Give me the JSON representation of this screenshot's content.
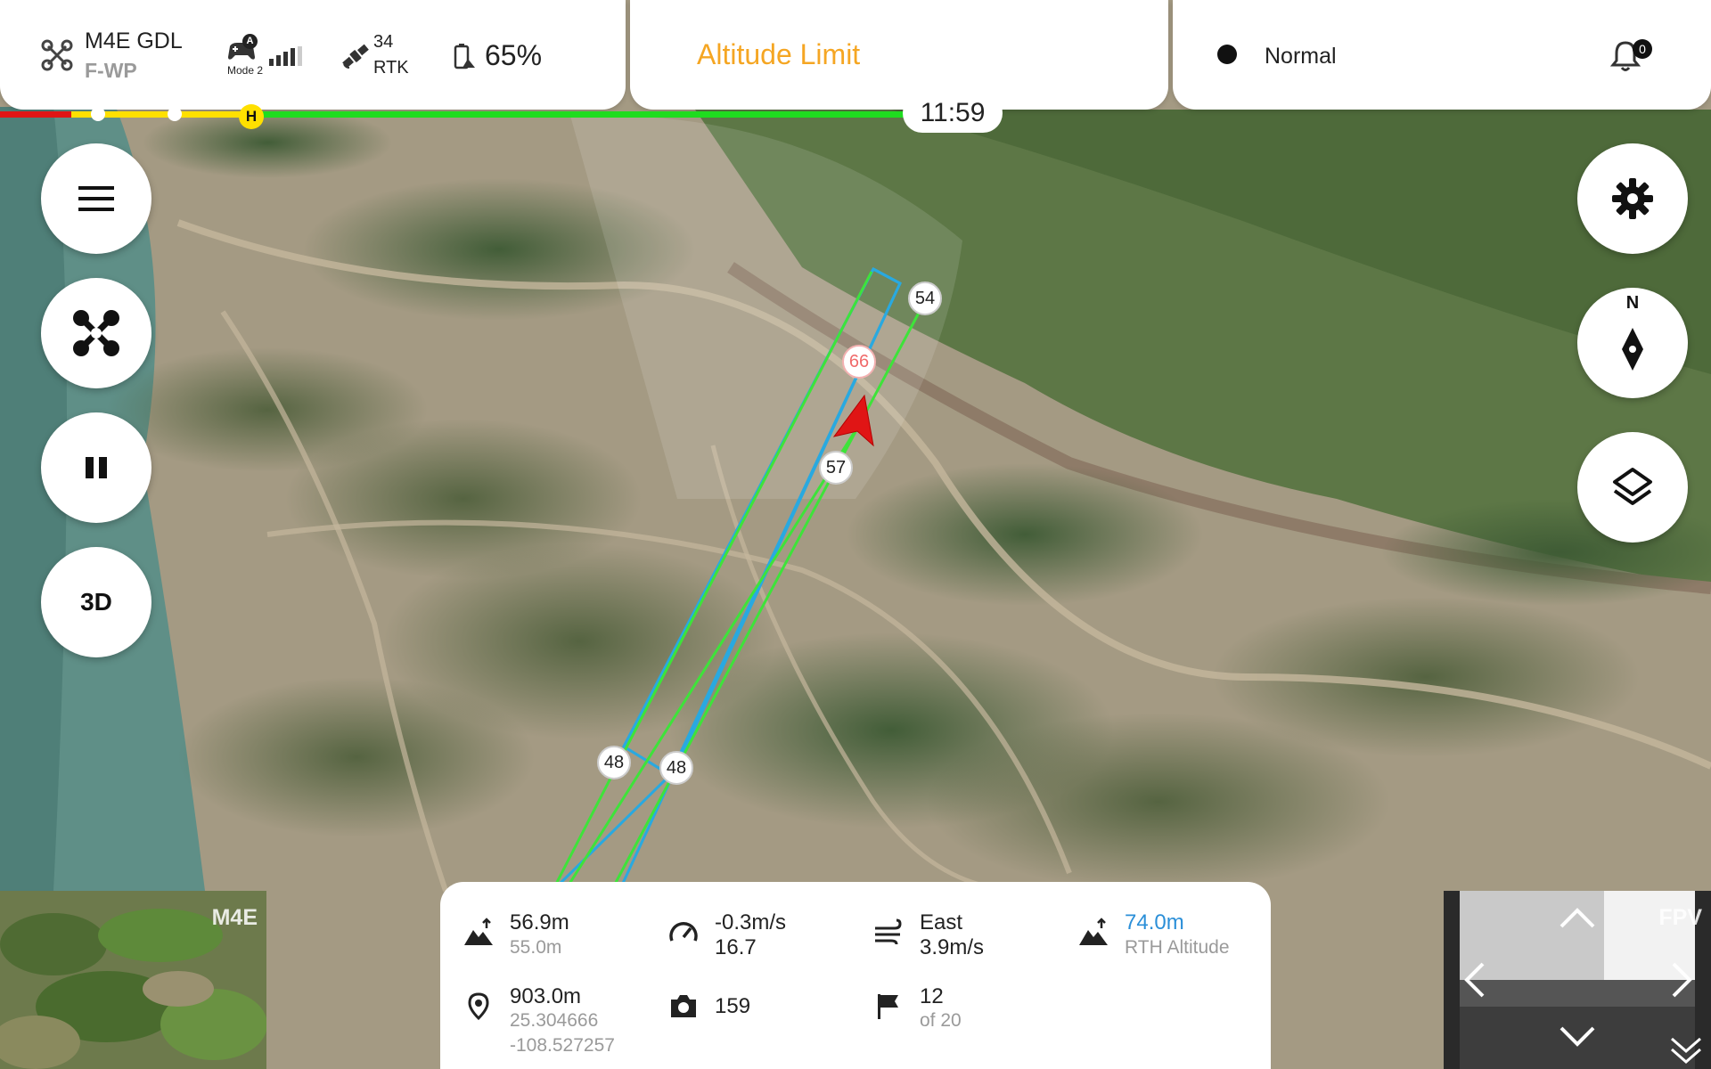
{
  "aircraft": {
    "model": "M4E GDL",
    "name": "F-WP"
  },
  "remote": {
    "mode": "Mode 2",
    "badge": "A"
  },
  "gnss": {
    "satellites": "34",
    "fix": "RTK"
  },
  "battery": {
    "percent": "65%"
  },
  "alert": {
    "text": "Altitude Limit",
    "color": "#f5a623"
  },
  "status": {
    "mode": "Normal",
    "notifications": "0"
  },
  "battery_bar": {
    "home_marker": "H",
    "remaining_time": "11:59"
  },
  "left_controls": [
    {
      "name": "menu-button",
      "icon": "hamburger-icon"
    },
    {
      "name": "aircraft-button",
      "icon": "drone-icon"
    },
    {
      "name": "pause-button",
      "icon": "pause-icon"
    },
    {
      "name": "view-3d-button",
      "label": "3D"
    }
  ],
  "right_controls": [
    {
      "name": "settings-button",
      "icon": "gear-icon"
    },
    {
      "name": "compass-button",
      "icon": "compass-icon",
      "label": "N"
    },
    {
      "name": "layers-button",
      "icon": "layers-icon"
    }
  ],
  "waypoints": [
    {
      "label": "54",
      "state": "normal"
    },
    {
      "label": "66",
      "state": "current"
    },
    {
      "label": "57",
      "state": "normal"
    },
    {
      "label": "48",
      "state": "normal"
    },
    {
      "label": "48",
      "state": "normal"
    }
  ],
  "telemetry": {
    "altitude": {
      "value": "56.9m",
      "sub": "55.0m",
      "icon": "altitude-icon"
    },
    "speed": {
      "value": "-0.3m/s",
      "sub": "16.7",
      "icon": "speedometer-icon"
    },
    "wind": {
      "value": "East",
      "sub": "3.9m/s",
      "icon": "wind-icon"
    },
    "rth": {
      "value": "74.0m",
      "sub": "RTH Altitude",
      "icon": "altitude-icon",
      "color": "#2b8fd8"
    },
    "distance": {
      "value": "903.0m",
      "lat": "25.304666",
      "lon": "-108.527257",
      "icon": "location-pin-icon"
    },
    "photos": {
      "value": "159",
      "icon": "camera-icon"
    },
    "waypoint_progress": {
      "value": "12",
      "sub": "of 20",
      "icon": "flag-icon"
    }
  },
  "cameras": {
    "main_label": "M4E",
    "fpv_label": "FPV"
  },
  "colors": {
    "route_green": "#3ee33a",
    "route_blue": "#29a9e0",
    "aircraft_red": "#e01515"
  }
}
